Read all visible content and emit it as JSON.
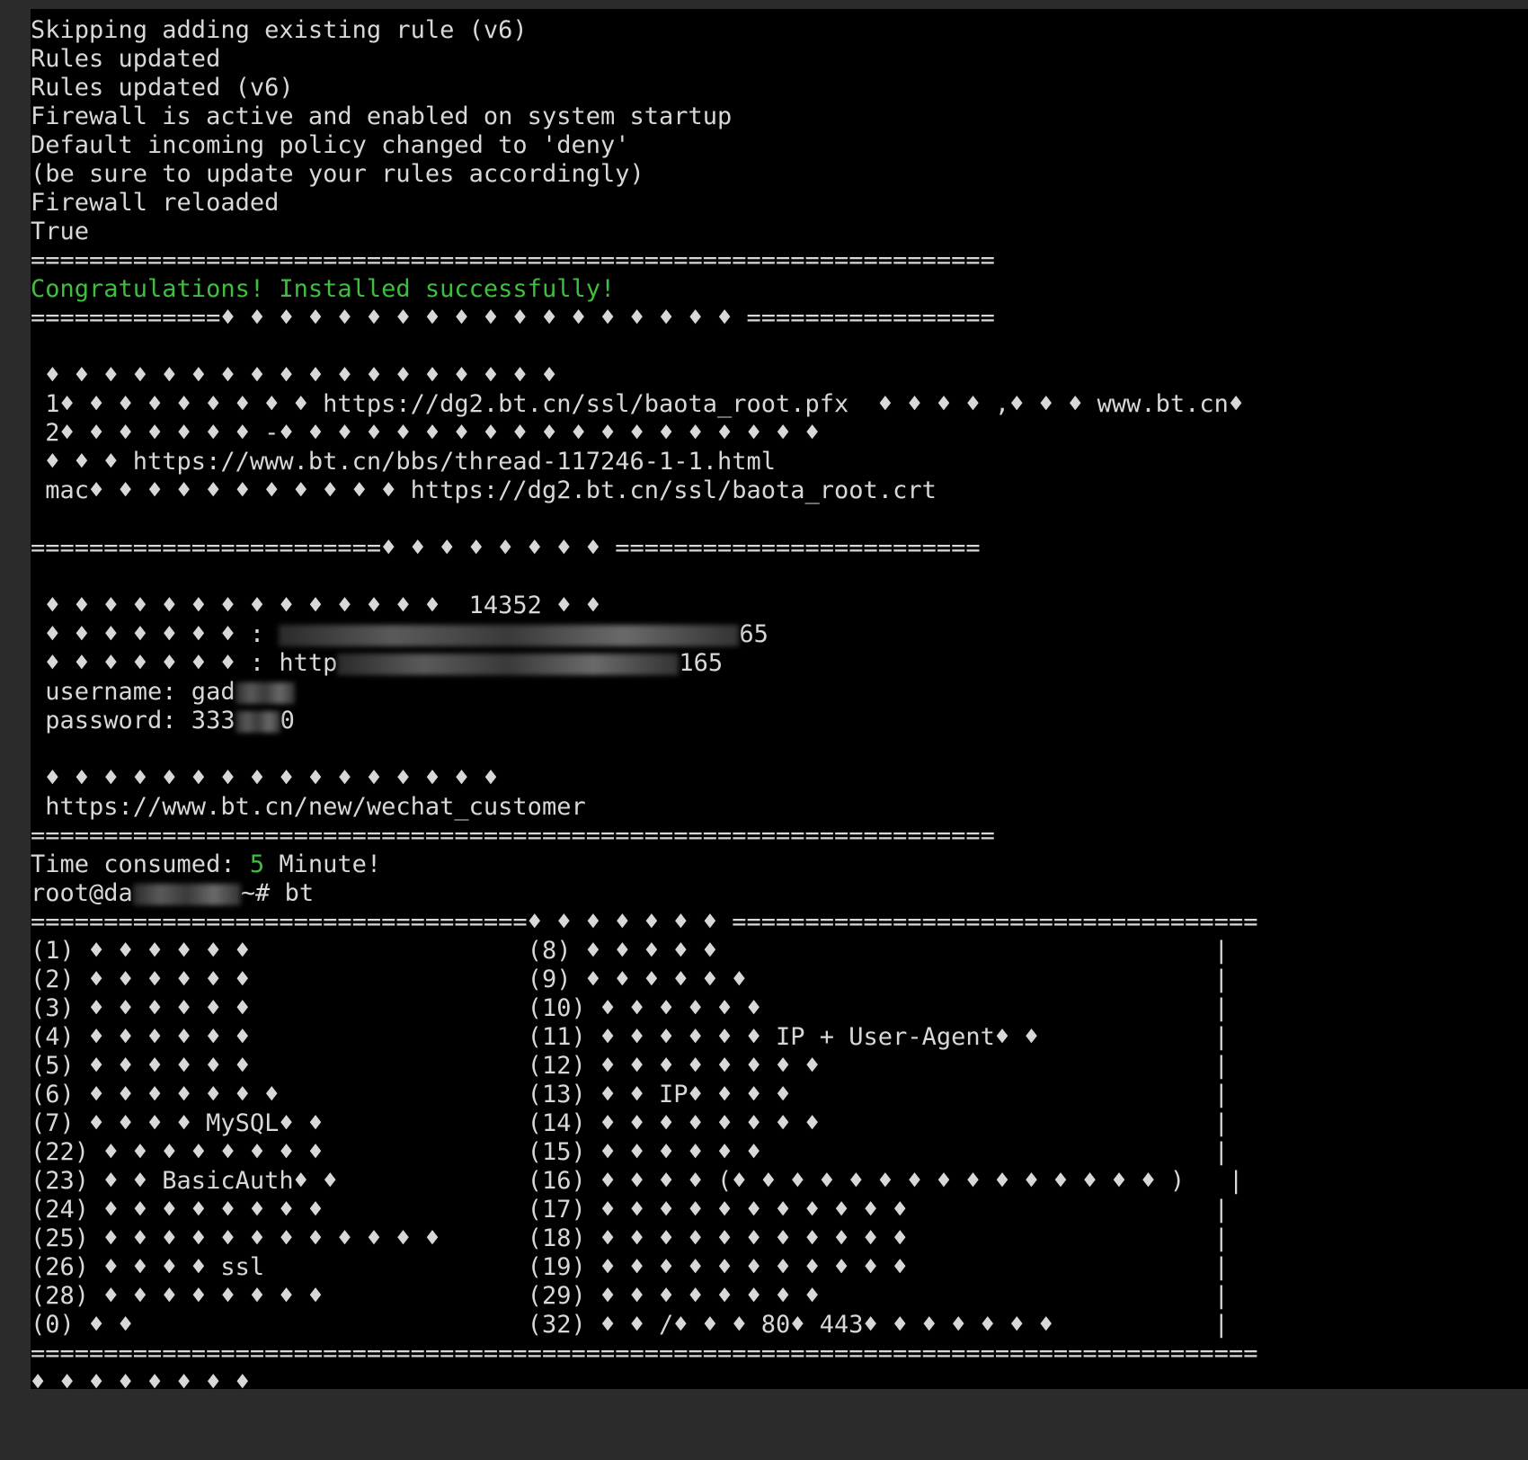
{
  "terminal": {
    "lines": {
      "l0": "Skipping adding existing rule (v6)",
      "l1": "Rules updated",
      "l2": "Rules updated (v6)",
      "l3": "Firewall is active and enabled on system startup",
      "l4": "Default incoming policy changed to 'deny'",
      "l5": "(be sure to update your rules accordingly)",
      "l6": "Firewall reloaded",
      "l7": "True",
      "l8": "==================================================================",
      "l9": "Congratulations! Installed successfully!",
      "l10": "=============♦ ♦ ♦ ♦ ♦ ♦ ♦ ♦ ♦ ♦ ♦ ♦ ♦ ♦ ♦ ♦ ♦ ♦ =================",
      "l12": " ♦ ♦ ♦ ♦ ♦ ♦ ♦ ♦ ♦ ♦ ♦ ♦ ♦ ♦ ♦ ♦ ♦ ♦",
      "l13": " 1♦ ♦ ♦ ♦ ♦ ♦ ♦ ♦ ♦ https://dg2.bt.cn/ssl/baota_root.pfx  ♦ ♦ ♦ ♦ ,♦ ♦ ♦ www.bt.cn♦",
      "l14": " 2♦ ♦ ♦ ♦ ♦ ♦ ♦ -♦ ♦ ♦ ♦ ♦ ♦ ♦ ♦ ♦ ♦ ♦ ♦ ♦ ♦ ♦ ♦ ♦ ♦ ♦",
      "l15": " ♦ ♦ ♦ https://www.bt.cn/bbs/thread-117246-1-1.html",
      "l16": " mac♦ ♦ ♦ ♦ ♦ ♦ ♦ ♦ ♦ ♦ ♦ https://dg2.bt.cn/ssl/baota_root.crt",
      "l18": "========================♦ ♦ ♦ ♦ ♦ ♦ ♦ ♦ =========================",
      "l20": " ♦ ♦ ♦ ♦ ♦ ♦ ♦ ♦ ♦ ♦ ♦ ♦ ♦ ♦  14352 ♦ ♦",
      "l21a": " ♦ ♦ ♦ ♦ ♦ ♦ ♦ : ",
      "l21b": "65",
      "l22a": " ♦ ♦ ♦ ♦ ♦ ♦ ♦ : http",
      "l22b": "165",
      "l23": " username: gad",
      "l24a": " password: 333",
      "l24b": "0",
      "l26": " ♦ ♦ ♦ ♦ ♦ ♦ ♦ ♦ ♦ ♦ ♦ ♦ ♦ ♦ ♦ ♦",
      "l27": " https://www.bt.cn/new/wechat_customer",
      "l28": "==================================================================",
      "l29a": "Time consumed: ",
      "l29b": "5",
      "l29c": " Minute!",
      "l30a": "root@da",
      "l30b": "~# bt",
      "l31": "==================================♦ ♦ ♦ ♦ ♦ ♦ ♦ ====================================",
      "l32": "(1) ♦ ♦ ♦ ♦ ♦ ♦                   (8) ♦ ♦ ♦ ♦ ♦                                  |",
      "l33": "(2) ♦ ♦ ♦ ♦ ♦ ♦                   (9) ♦ ♦ ♦ ♦ ♦ ♦                                |",
      "l34": "(3) ♦ ♦ ♦ ♦ ♦ ♦                   (10) ♦ ♦ ♦ ♦ ♦ ♦                               |",
      "l35": "(4) ♦ ♦ ♦ ♦ ♦ ♦                   (11) ♦ ♦ ♦ ♦ ♦ ♦ IP + User-Agent♦ ♦            |",
      "l36": "(5) ♦ ♦ ♦ ♦ ♦ ♦                   (12) ♦ ♦ ♦ ♦ ♦ ♦ ♦ ♦                           |",
      "l37": "(6) ♦ ♦ ♦ ♦ ♦ ♦ ♦                 (13) ♦ ♦ IP♦ ♦ ♦ ♦                             |",
      "l38": "(7) ♦ ♦ ♦ ♦ MySQL♦ ♦              (14) ♦ ♦ ♦ ♦ ♦ ♦ ♦ ♦                           |",
      "l39": "(22) ♦ ♦ ♦ ♦ ♦ ♦ ♦ ♦              (15) ♦ ♦ ♦ ♦ ♦ ♦                               |",
      "l40": "(23) ♦ ♦ BasicAuth♦ ♦             (16) ♦ ♦ ♦ ♦ (♦ ♦ ♦ ♦ ♦ ♦ ♦ ♦ ♦ ♦ ♦ ♦ ♦ ♦ ♦ )   |",
      "l41": "(24) ♦ ♦ ♦ ♦ ♦ ♦ ♦ ♦              (17) ♦ ♦ ♦ ♦ ♦ ♦ ♦ ♦ ♦ ♦ ♦                     |",
      "l42": "(25) ♦ ♦ ♦ ♦ ♦ ♦ ♦ ♦ ♦ ♦ ♦ ♦      (18) ♦ ♦ ♦ ♦ ♦ ♦ ♦ ♦ ♦ ♦ ♦                     |",
      "l43": "(26) ♦ ♦ ♦ ♦ ssl                  (19) ♦ ♦ ♦ ♦ ♦ ♦ ♦ ♦ ♦ ♦ ♦                     |",
      "l44": "(28) ♦ ♦ ♦ ♦ ♦ ♦ ♦ ♦              (29) ♦ ♦ ♦ ♦ ♦ ♦ ♦ ♦                           |",
      "l45": "(0) ♦ ♦                           (32) ♦ ♦ /♦ ♦ ♦ 80♦ 443♦ ♦ ♦ ♦ ♦ ♦ ♦           |",
      "l46": "====================================================================================",
      "l47": "♦ ♦ ♦ ♦ ♦ ♦ ♦ ♦"
    }
  },
  "colors": {
    "terminal_bg": "#000000",
    "text": "#d8d8d8",
    "success": "#3fbf3f",
    "window_bg": "#2b2b2b"
  }
}
